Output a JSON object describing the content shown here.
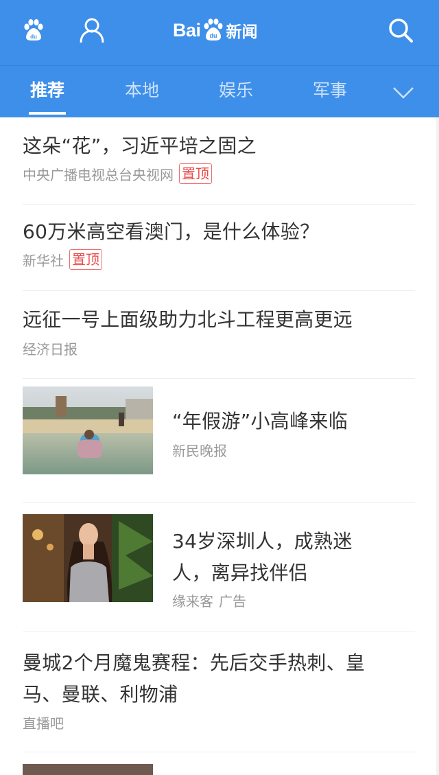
{
  "header": {
    "logo_text": "Bai",
    "logo_paw_text": "du",
    "logo_suffix": "新闻"
  },
  "tabs": [
    {
      "label": "推荐",
      "active": true
    },
    {
      "label": "本地",
      "active": false
    },
    {
      "label": "娱乐",
      "active": false
    },
    {
      "label": "军事",
      "active": false
    }
  ],
  "feed": [
    {
      "title": "这朵“花”，习近平培之固之",
      "source": "中央广播电视总台央视网",
      "tag": "置顶"
    },
    {
      "title": "60万米高空看澳门，是什么体验？",
      "source": "新华社",
      "tag": "置顶"
    },
    {
      "title": "远征一号上面级助力北斗工程更高更远",
      "source": "经济日报"
    },
    {
      "title": "“年假游”小高峰来临",
      "source": "新民晚报",
      "image": "beach-kid-photo"
    },
    {
      "title_line1": "34岁深圳人，成熟迷",
      "title_line2": "人，离异找伴侣",
      "source": "缘来客",
      "ad": "广告",
      "image": "woman-portrait-photo"
    },
    {
      "title_line1": "曼城2个月魔鬼赛程：先后交手热刺、皇",
      "title_line2": "马、曼联、利物浦",
      "source": "直播吧"
    }
  ],
  "colors": {
    "header_bg": "#3e8fea",
    "tag_red": "#e84b4b",
    "meta_gray": "#999999"
  }
}
